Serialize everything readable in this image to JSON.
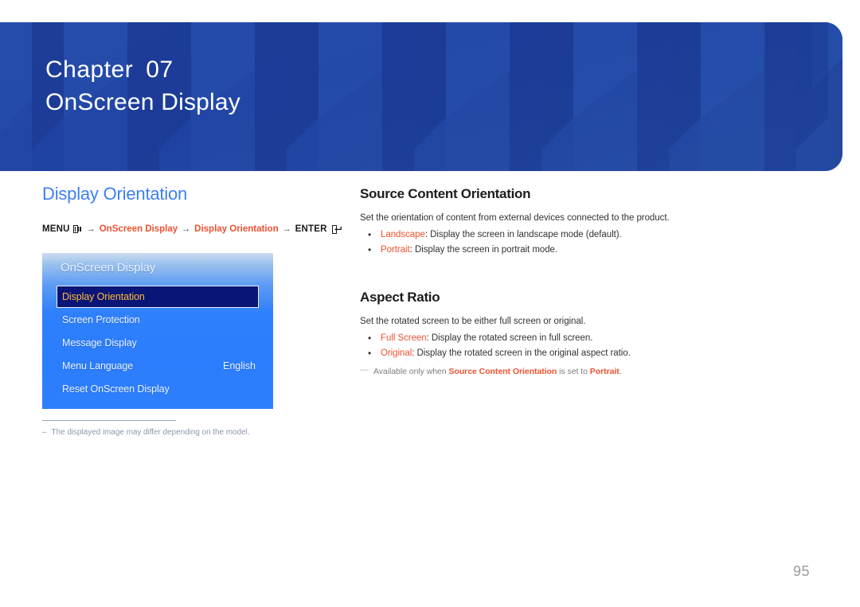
{
  "banner": {
    "chapter_label": "Chapter",
    "chapter_number": "07",
    "chapter_title": "OnScreen Display",
    "bg_color": "#1f47a8"
  },
  "left": {
    "section_heading": "Display Orientation",
    "heading_color": "#3d7ff5",
    "breadcrumb": {
      "menu_label": "MENU",
      "menu_icon": "menu-bars-icon",
      "arrow1": "→",
      "link1": "OnScreen Display",
      "arrow2": "→",
      "link2": "Display Orientation",
      "arrow3": "→",
      "enter_label": "ENTER",
      "enter_icon": "enter-return-icon",
      "link_color": "#ef5130"
    },
    "osd_menu": {
      "title": "OnScreen Display",
      "items": [
        {
          "label": "Display Orientation",
          "value": "",
          "selected": true
        },
        {
          "label": "Screen Protection",
          "value": "",
          "selected": false
        },
        {
          "label": "Message Display",
          "value": "",
          "selected": false
        },
        {
          "label": "Menu Language",
          "value": "English",
          "selected": false
        },
        {
          "label": "Reset OnScreen Display",
          "value": "",
          "selected": false
        }
      ],
      "selected_bg": "#0a1578",
      "selected_text_color": "#ffbb33"
    },
    "footnote": {
      "dash": "–",
      "text": "The displayed image may differ depending on the model."
    }
  },
  "right": {
    "sections": [
      {
        "heading": "Source Content Orientation",
        "intro": "Set the orientation of content from external devices connected to the product.",
        "bullets": [
          {
            "term": "Landscape",
            "rest": ": Display the screen in landscape mode (default)."
          },
          {
            "term": "Portrait",
            "rest": ": Display the screen in portrait mode."
          }
        ]
      },
      {
        "heading": "Aspect Ratio",
        "intro": "Set the rotated screen to be either full screen or original.",
        "bullets": [
          {
            "term": "Full Screen",
            "rest": ": Display the rotated screen in full screen."
          },
          {
            "term": "Original",
            "rest": ": Display the rotated screen in the original aspect ratio."
          }
        ],
        "note": {
          "dash": "—",
          "part1": "Available only when ",
          "term1": "Source Content Orientation",
          "part2": " is set to ",
          "term2": "Portrait",
          "part3": "."
        }
      }
    ]
  },
  "page_number": "95"
}
